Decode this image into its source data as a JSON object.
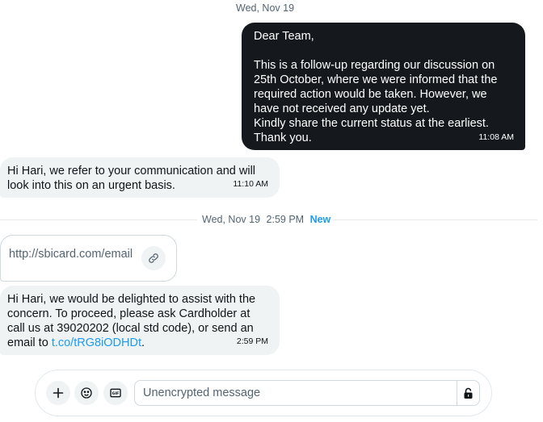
{
  "thread": {
    "date_top": "Wed, Nov 19",
    "outgoing": {
      "text": "Dear Team,\n\nThis is a follow-up regarding our discussion on 25th October, where we were informed that the required action would be taken. However, we have not received any update yet.\nKindly share the current status at the earliest.\nThank you.",
      "time": "11:08 AM"
    },
    "reply1": {
      "text": "Hi Hari, we refer to your communication and will look into this on an urgent basis.",
      "time": "11:10 AM"
    },
    "divider": {
      "date": "Wed, Nov 19",
      "time": "2:59 PM",
      "new_label": "New"
    },
    "link_card": {
      "url": "http://sbicard.com/email",
      "icon": "link-icon"
    },
    "reply2": {
      "text_before": "Hi Hari, we would be delighted to assist with the concern. To proceed, please ask Cardholder at call us at 39020202 (local std code), or send an email to ",
      "link": "t.co/tRG8iODHDt",
      "text_after": ".",
      "time": "2:59 PM"
    }
  },
  "composer": {
    "placeholder": "Unencrypted message",
    "value": "",
    "icons": [
      "plus-icon",
      "emoji-icon",
      "gif-icon",
      "lock-icon"
    ]
  },
  "colors": {
    "outgoing_bubble": "#15191e",
    "incoming_bubble": "#eff3f4",
    "link": "#1d9bf0",
    "muted": "#536471"
  }
}
